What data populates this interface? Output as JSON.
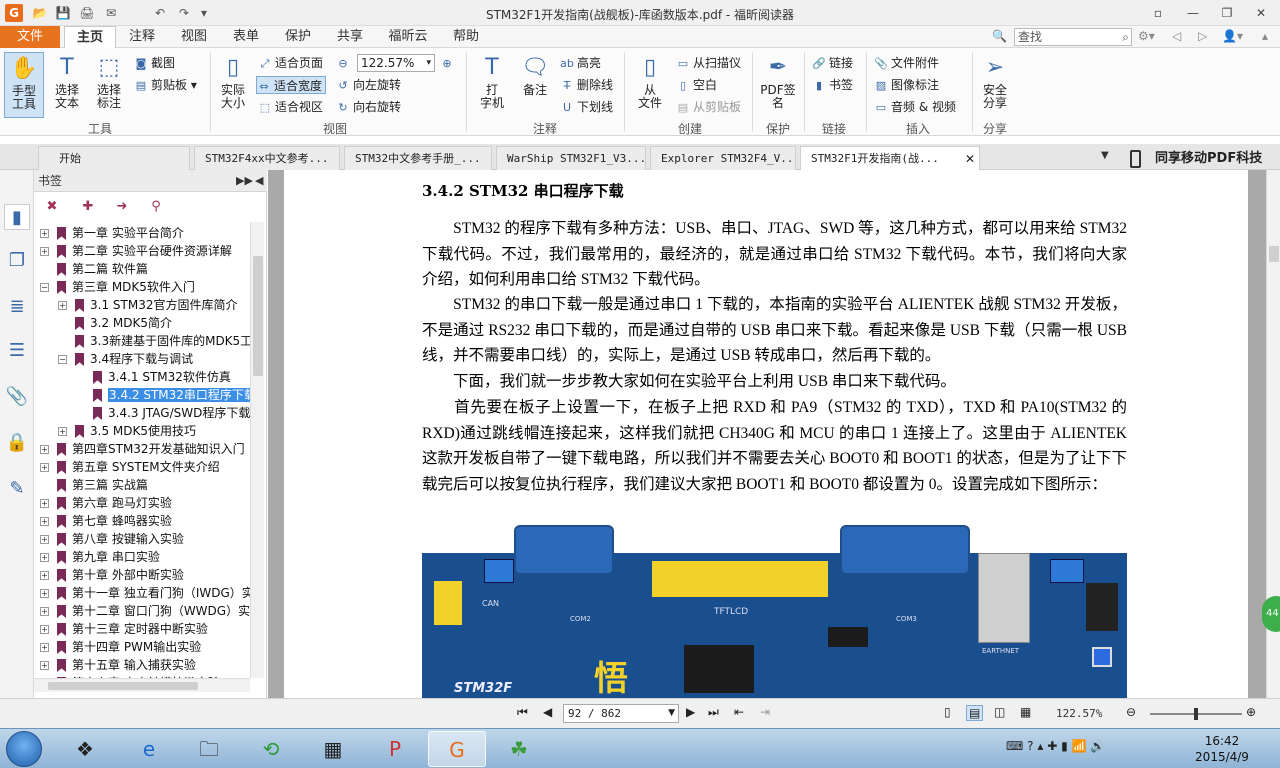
{
  "window": {
    "title": "STM32F1开发指南(战舰板)-库函数版本.pdf - 福昕阅读器",
    "app_icon": "G",
    "controls": [
      "▫",
      "—",
      "❐",
      "✕"
    ]
  },
  "quick_access": [
    "📂",
    "💾",
    "🖨",
    "✉",
    "↶",
    "↷",
    "▾"
  ],
  "menu": {
    "file": "文件",
    "tabs": [
      "主页",
      "注释",
      "视图",
      "表单",
      "保护",
      "共享",
      "福昕云",
      "帮助"
    ],
    "active_tab": "主页",
    "search_placeholder": "查找"
  },
  "ribbon": {
    "hand_tool": "手型\n工具",
    "select_text": "选择\n文本",
    "select_annot": "选择\n标注",
    "screenshot": "截图",
    "clipboard": "剪贴板",
    "group_tools": "工具",
    "actual_size": "实际\n大小",
    "fit_page": "适合页面",
    "fit_width": "适合宽度",
    "fit_view": "适合视区",
    "zoom_value": "122.57%",
    "rotate_left": "向左旋转",
    "rotate_right": "向右旋转",
    "group_view": "视图",
    "typewriter": "打\n字机",
    "note": "备注",
    "highlight": "高亮",
    "strikeout": "删除线",
    "underline": "下划线",
    "group_comment": "注释",
    "from_file": "从\n文件",
    "from_scanner": "从扫描仪",
    "blank": "空白",
    "from_clipboard": "从剪贴板",
    "group_create": "创建",
    "pdf_sign": "PDF签\n名",
    "group_protect": "保护",
    "link": "链接",
    "bookmark": "书签",
    "group_links": "链接",
    "file_attachment": "文件附件",
    "image_annot": "图像标注",
    "audio_video": "音频 & 视频",
    "group_insert": "插入",
    "secure_share": "安全\n分享",
    "group_share": "分享"
  },
  "doc_tabs": [
    "开始",
    "STM32F4xx中文参考...",
    "STM32中文参考手册_...",
    "WarShip STM32F1_V3...",
    "Explorer STM32F4_V...",
    "STM32F1开发指南(战..."
  ],
  "promo_text": "同享移动PDF科技",
  "bookmarks": {
    "header": "书签",
    "items": [
      {
        "label": "第一章 实验平台简介",
        "level": 0,
        "expander": "+"
      },
      {
        "label": "第二章 实验平台硬件资源详解",
        "level": 0,
        "expander": "+"
      },
      {
        "label": "第二篇 软件篇",
        "level": 0,
        "expander": ""
      },
      {
        "label": "第三章 MDK5软件入门",
        "level": 0,
        "expander": "−"
      },
      {
        "label": "3.1 STM32官方固件库简介",
        "level": 1,
        "expander": "+"
      },
      {
        "label": "3.2 MDK5简介",
        "level": 1,
        "expander": ""
      },
      {
        "label": "3.3新建基于固件库的MDK5工",
        "level": 1,
        "expander": ""
      },
      {
        "label": "3.4程序下载与调试",
        "level": 1,
        "expander": "−"
      },
      {
        "label": "3.4.1 STM32软件仿真",
        "level": 2,
        "expander": ""
      },
      {
        "label": "3.4.2 STM32串口程序下载",
        "level": 2,
        "expander": "",
        "selected": true
      },
      {
        "label": "3.4.3 JTAG/SWD程序下载",
        "level": 2,
        "expander": ""
      },
      {
        "label": "3.5 MDK5使用技巧",
        "level": 1,
        "expander": "+"
      },
      {
        "label": "第四章STM32开发基础知识入门",
        "level": 0,
        "expander": "+"
      },
      {
        "label": "第五章 SYSTEM文件夹介绍",
        "level": 0,
        "expander": "+"
      },
      {
        "label": "第三篇 实战篇",
        "level": 0,
        "expander": ""
      },
      {
        "label": "第六章 跑马灯实验",
        "level": 0,
        "expander": "+"
      },
      {
        "label": "第七章 蜂鸣器实验",
        "level": 0,
        "expander": "+"
      },
      {
        "label": "第八章 按键输入实验",
        "level": 0,
        "expander": "+"
      },
      {
        "label": "第九章 串口实验",
        "level": 0,
        "expander": "+"
      },
      {
        "label": "第十章 外部中断实验",
        "level": 0,
        "expander": "+"
      },
      {
        "label": "第十一章 独立看门狗（IWDG）实",
        "level": 0,
        "expander": "+"
      },
      {
        "label": "第十二章 窗口门狗（WWDG）实",
        "level": 0,
        "expander": "+"
      },
      {
        "label": "第十三章 定时器中断实验",
        "level": 0,
        "expander": "+"
      },
      {
        "label": "第十四章 PWM输出实验",
        "level": 0,
        "expander": "+"
      },
      {
        "label": "第十五章 输入捕获实验",
        "level": 0,
        "expander": "+"
      },
      {
        "label": "第十六章 电容触摸按键实验",
        "level": 0,
        "expander": "+"
      }
    ]
  },
  "document": {
    "heading": "3.4.2 STM32 串口程序下载",
    "paragraphs": [
      "　　STM32 的程序下载有多种方法：USB、串口、JTAG、SWD 等，这几种方式，都可以用来给 STM32 下载代码。不过，我们最常用的，最经济的，就是通过串口给 STM32 下载代码。本节，我们将向大家介绍，如何利用串口给 STM32 下载代码。",
      "　　STM32 的串口下载一般是通过串口 1 下载的，本指南的实验平台 ALIENTEK 战舰 STM32 开发板，不是通过 RS232 串口下载的，而是通过自带的 USB 串口来下载。看起来像是 USB 下载（只需一根 USB 线，并不需要串口线）的，实际上，是通过 USB 转成串口，然后再下载的。",
      "　　下面，我们就一步步教大家如何在实验平台上利用 USB 串口来下载代码。",
      "　　首先要在板子上设置一下，在板子上把 RXD 和 PA9（STM32 的 TXD），TXD 和 PA10(STM32 的 RXD)通过跳线帽连接起来，这样我们就把 CH340G 和 MCU 的串口 1 连接上了。这里由于 ALIENTEK 这款开发板自带了一键下载电路，所以我们并不需要去关心 BOOT0 和 BOOT1 的状态，但是为了让下下载完后可以按复位执行程序，我们建议大家把 BOOT1 和 BOOT0 都设置为 0。设置完成如下图所示："
    ],
    "photo_labels": {
      "tftlcd": "TFTLCD",
      "stm32": "STM32F",
      "wu": "悟",
      "can": "CAN",
      "com2": "COM2",
      "com3": "COM3",
      "earthnet": "EARTHNET"
    }
  },
  "status": {
    "page_display": "92 / 862",
    "zoom": "122.57%"
  },
  "float_badge": "44",
  "taskbar": {
    "time": "16:42",
    "date": "2015/4/9"
  }
}
